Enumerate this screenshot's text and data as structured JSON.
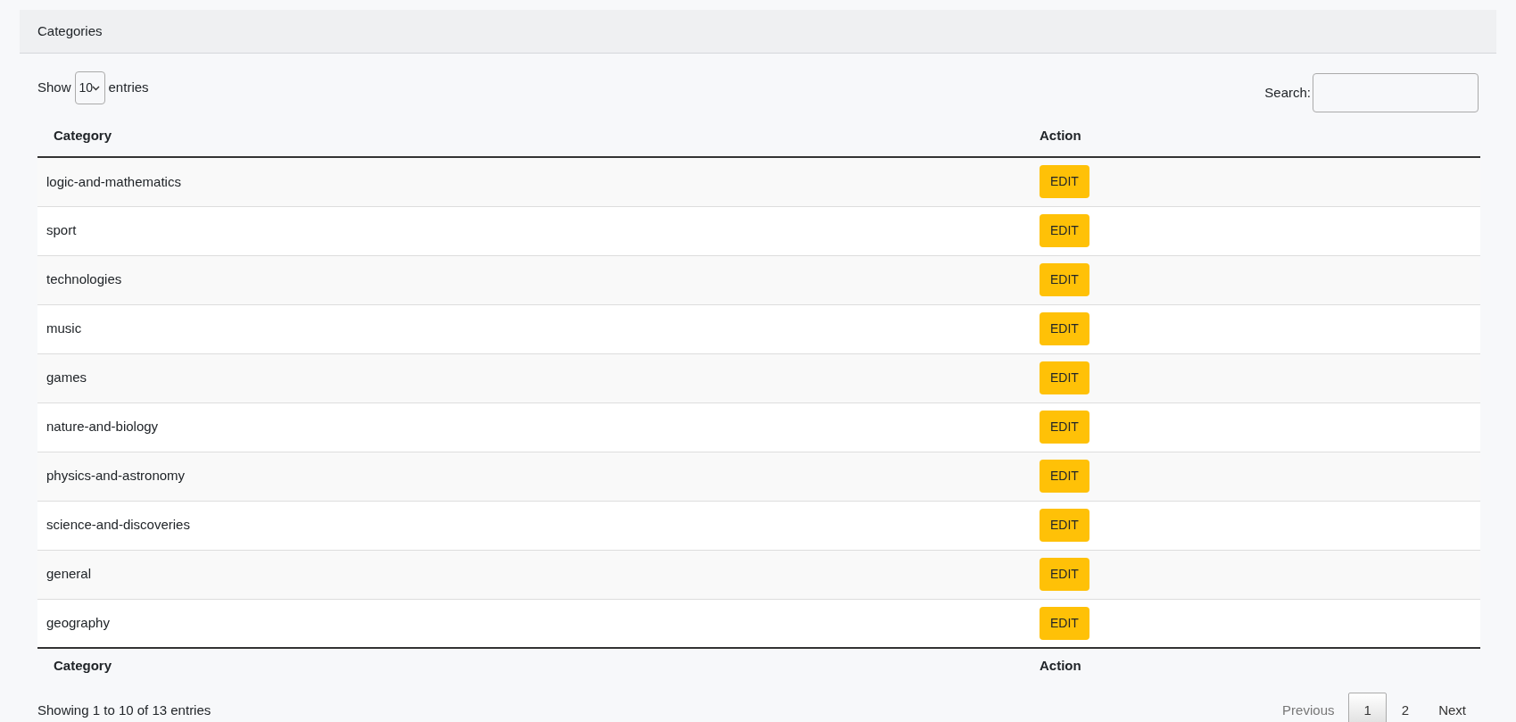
{
  "card": {
    "title": "Categories"
  },
  "length_control": {
    "label_before": "Show",
    "value": "10",
    "label_after": "entries"
  },
  "search": {
    "label": "Search:"
  },
  "table": {
    "columns": [
      "Category",
      "Action"
    ],
    "rows": [
      {
        "category": "logic-and-mathematics",
        "action": "EDIT"
      },
      {
        "category": "sport",
        "action": "EDIT"
      },
      {
        "category": "technologies",
        "action": "EDIT"
      },
      {
        "category": "music",
        "action": "EDIT"
      },
      {
        "category": "games",
        "action": "EDIT"
      },
      {
        "category": "nature-and-biology",
        "action": "EDIT"
      },
      {
        "category": "physics-and-astronomy",
        "action": "EDIT"
      },
      {
        "category": "science-and-discoveries",
        "action": "EDIT"
      },
      {
        "category": "general",
        "action": "EDIT"
      },
      {
        "category": "geography",
        "action": "EDIT"
      }
    ],
    "footer_columns": [
      "Category",
      "Action"
    ]
  },
  "info": "Showing 1 to 10 of 13 entries",
  "pagination": {
    "previous": {
      "label": "Previous",
      "disabled": true
    },
    "pages": [
      {
        "label": "1",
        "selected": true
      },
      {
        "label": "2",
        "selected": false
      }
    ],
    "next": {
      "label": "Next",
      "disabled": false
    }
  }
}
